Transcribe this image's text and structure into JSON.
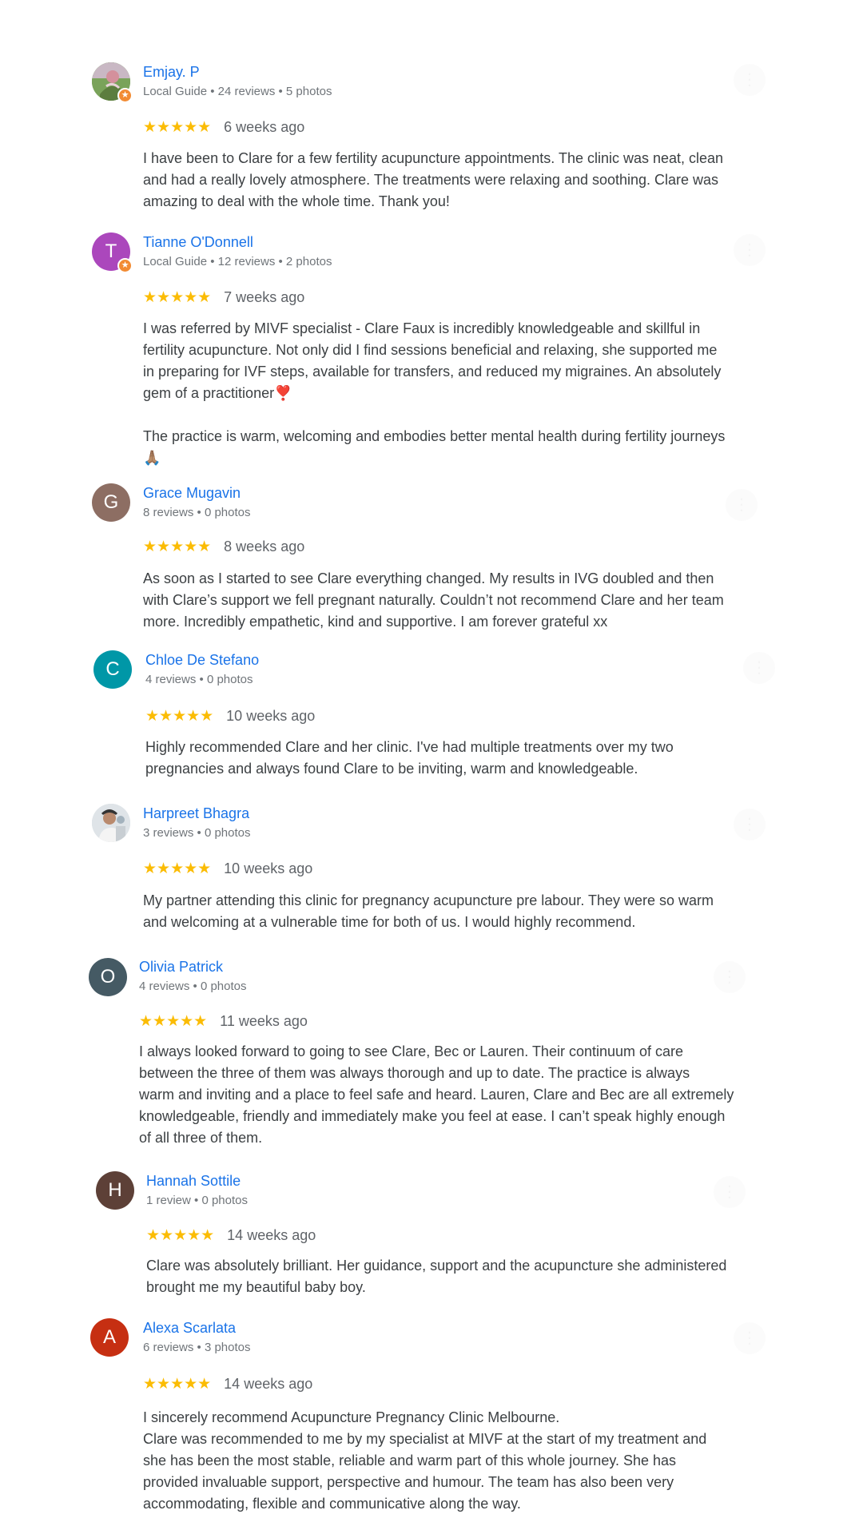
{
  "reviews": [
    {
      "name": "Emjay. P",
      "meta": "Local Guide • 24 reviews • 5 photos",
      "avatar_letter": "",
      "avatar_color": "#6b8e4e",
      "stars": "★★★★★",
      "date": "6 weeks ago",
      "text": "I have been to Clare for a few fertility acupuncture appointments. The clinic was neat, clean\nand had a really lovely atmosphere. The treatments were relaxing and soothing. Clare was\namazing to deal with the whole time. Thank you!"
    },
    {
      "name": "Tianne O'Donnell",
      "meta": "Local Guide • 12 reviews • 2 photos",
      "avatar_letter": "T",
      "avatar_color": "#ab47bc",
      "stars": "★★★★★",
      "date": "7 weeks ago",
      "text": "I was referred by MIVF specialist - Clare Faux is incredibly knowledgeable and skillful in\nfertility acupuncture. Not only did I find sessions beneficial and relaxing, she supported me\nin preparing for IVF steps, available for transfers, and reduced my migraines. An absolutely\ngem of a practitioner❣️\n\nThe practice is warm, welcoming and embodies better mental health during fertility journeys\n🙏🏽"
    },
    {
      "name": "Grace Mugavin",
      "meta": "8 reviews • 0 photos",
      "avatar_letter": "G",
      "avatar_color": "#8d6e63",
      "stars": "★★★★★",
      "date": "8 weeks ago",
      "text": "As soon as I started to see Clare everything changed. My results in IVG doubled and then\nwith Clare’s support we fell pregnant naturally. Couldn’t not recommend Clare and her team\nmore. Incredibly empathetic, kind and supportive. I am forever grateful xx"
    },
    {
      "name": "Chloe De Stefano",
      "meta": "4 reviews • 0 photos",
      "avatar_letter": "C",
      "avatar_color": "#0097a7",
      "stars": "★★★★★",
      "date": "10 weeks ago",
      "text": "Highly recommended Clare and her clinic. I've had multiple treatments over my two\npregnancies and always found Clare to be inviting, warm and knowledgeable."
    },
    {
      "name": "Harpreet Bhagra",
      "meta": "3 reviews • 0 photos",
      "avatar_letter": "",
      "avatar_color": "#cfd8dc",
      "stars": "★★★★★",
      "date": "10 weeks ago",
      "text": "My partner attending this clinic for pregnancy acupuncture pre labour. They were so warm\nand welcoming at a vulnerable time for both of us. I would highly recommend."
    },
    {
      "name": "Olivia Patrick",
      "meta": "4 reviews • 0 photos",
      "avatar_letter": "O",
      "avatar_color": "#455a64",
      "stars": "★★★★★",
      "date": "11 weeks ago",
      "text": "I always looked forward to going to see Clare, Bec or Lauren. Their continuum of care\nbetween the three of them was always thorough and up to date. The practice is always\nwarm and inviting and a place to feel safe and heard. Lauren, Clare and Bec are all extremely\nknowledgeable, friendly and immediately make you feel at ease. I can’t speak highly enough\nof all three of them."
    },
    {
      "name": "Hannah Sottile",
      "meta": "1 review • 0 photos",
      "avatar_letter": "H",
      "avatar_color": "#5d4037",
      "stars": "★★★★★",
      "date": "14 weeks ago",
      "text": "Clare was absolutely brilliant. Her guidance, support and the acupuncture she administered\nbrought me my beautiful baby boy."
    },
    {
      "name": "Alexa Scarlata",
      "meta": "6 reviews • 3 photos",
      "avatar_letter": "A",
      "avatar_color": "#c62f12",
      "stars": "★★★★★",
      "date": "14 weeks ago",
      "text": "I sincerely recommend Acupuncture Pregnancy Clinic Melbourne.\nClare was recommended to me by my specialist at MIVF at the start of my treatment and\nshe has been the most stable, reliable and warm part of this whole journey. She has\nprovided invaluable support, perspective and humour. The team has also been very\naccommodating, flexible and communicative along the way."
    }
  ],
  "icons": {
    "more": "more-vert-icon",
    "local_guide": "local-guide-badge-icon",
    "star": "star-icon"
  }
}
